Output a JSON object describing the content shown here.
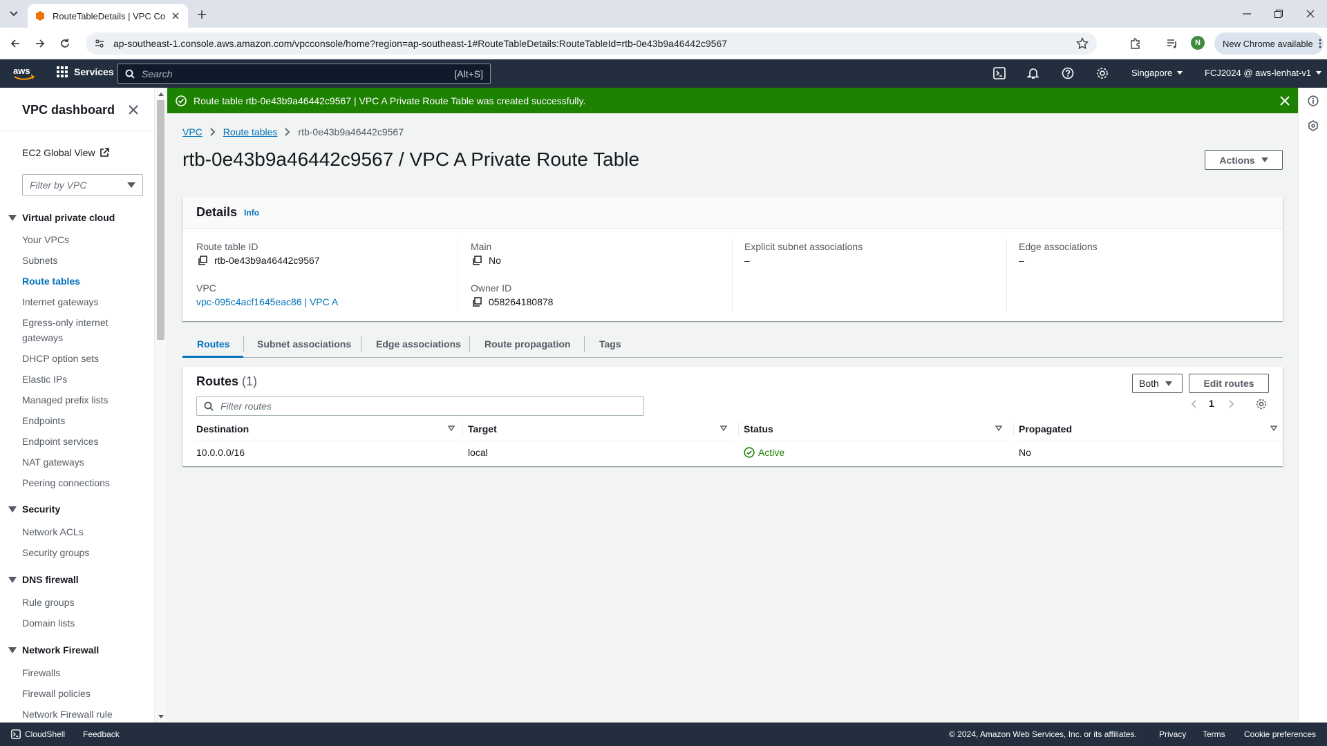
{
  "browser": {
    "tab_title": "RouteTableDetails | VPC Consol",
    "url": "ap-southeast-1.console.aws.amazon.com/vpcconsole/home?region=ap-southeast-1#RouteTableDetails:RouteTableId=rtb-0e43b9a46442c9567",
    "profile_initial": "N",
    "update_label": "New Chrome available"
  },
  "aws_header": {
    "logo": "aws",
    "services_label": "Services",
    "search_placeholder": "Search",
    "search_shortcut": "[Alt+S]",
    "region": "Singapore",
    "account": "FCJ2024 @ aws-lenhat-v1"
  },
  "sidebar": {
    "title": "VPC dashboard",
    "ec2_global_view": "EC2 Global View",
    "filter_placeholder": "Filter by VPC",
    "sections": [
      {
        "title": "Virtual private cloud",
        "items": [
          "Your VPCs",
          "Subnets",
          "Route tables",
          "Internet gateways",
          "Egress-only internet gateways",
          "DHCP option sets",
          "Elastic IPs",
          "Managed prefix lists",
          "Endpoints",
          "Endpoint services",
          "NAT gateways",
          "Peering connections"
        ]
      },
      {
        "title": "Security",
        "items": [
          "Network ACLs",
          "Security groups"
        ]
      },
      {
        "title": "DNS firewall",
        "items": [
          "Rule groups",
          "Domain lists"
        ]
      },
      {
        "title": "Network Firewall",
        "items": [
          "Firewalls",
          "Firewall policies",
          "Network Firewall rule"
        ]
      }
    ],
    "active_item": "Route tables"
  },
  "flash": {
    "message": "Route table rtb-0e43b9a46442c9567 | VPC A Private Route Table was created successfully.",
    "color": "#1d8102"
  },
  "breadcrumb": {
    "items": [
      "VPC",
      "Route tables",
      "rtb-0e43b9a46442c9567"
    ]
  },
  "page": {
    "title": "rtb-0e43b9a46442c9567 / VPC A Private Route Table",
    "actions_label": "Actions"
  },
  "details": {
    "heading": "Details",
    "info_label": "Info",
    "route_table_id_label": "Route table ID",
    "route_table_id": "rtb-0e43b9a46442c9567",
    "vpc_label": "VPC",
    "vpc": "vpc-095c4acf1645eac86 | VPC A",
    "main_label": "Main",
    "main": "No",
    "owner_id_label": "Owner ID",
    "owner_id": "058264180878",
    "explicit_label": "Explicit subnet associations",
    "explicit": "–",
    "edge_label": "Edge associations",
    "edge": "–"
  },
  "tabs": [
    "Routes",
    "Subnet associations",
    "Edge associations",
    "Route propagation",
    "Tags"
  ],
  "routes": {
    "title": "Routes",
    "count": "(1)",
    "filter_placeholder": "Filter routes",
    "both_label": "Both",
    "edit_label": "Edit routes",
    "page_number": "1",
    "columns": [
      "Destination",
      "Target",
      "Status",
      "Propagated"
    ],
    "rows": [
      {
        "destination": "10.0.0.0/16",
        "target": "local",
        "status": "Active",
        "propagated": "No"
      }
    ]
  },
  "footer": {
    "cloudshell": "CloudShell",
    "feedback": "Feedback",
    "copyright": "© 2024, Amazon Web Services, Inc. or its affiliates.",
    "privacy": "Privacy",
    "terms": "Terms",
    "cookies": "Cookie preferences"
  },
  "colors": {
    "accent": "#0073bb",
    "header_bg": "#232f3e",
    "success": "#1d8102"
  }
}
